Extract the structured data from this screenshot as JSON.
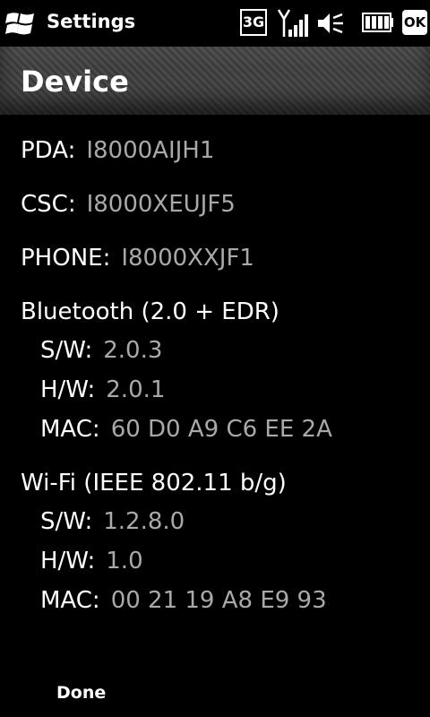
{
  "statusbar": {
    "app_title": "Settings",
    "network": "3G",
    "ok_label": "OK",
    "icons": [
      "windows-start-icon",
      "signal-strength-icon",
      "volume-mute-icon",
      "battery-icon"
    ]
  },
  "header": {
    "title": "Device"
  },
  "info": {
    "pda_label": "PDA:",
    "pda_value": "I8000AIJH1",
    "csc_label": "CSC:",
    "csc_value": "I8000XEUJF5",
    "phone_label": "PHONE:",
    "phone_value": "I8000XXJF1",
    "bluetooth": {
      "heading": "Bluetooth (2.0 + EDR)",
      "sw_label": "S/W:",
      "sw_value": "2.0.3",
      "hw_label": "H/W:",
      "hw_value": "2.0.1",
      "mac_label": "MAC:",
      "mac_value": "60 D0 A9 C6 EE 2A"
    },
    "wifi": {
      "heading": "Wi-Fi (IEEE 802.11 b/g)",
      "sw_label": "S/W:",
      "sw_value": "1.2.8.0",
      "hw_label": "H/W:",
      "hw_value": "1.0",
      "mac_label": "MAC:",
      "mac_value": "00 21 19 A8 E9 93"
    }
  },
  "softkeys": {
    "left": "Done"
  },
  "colors": {
    "background": "#000000",
    "value_text": "#a9a9a9",
    "label_text": "#ffffff"
  }
}
